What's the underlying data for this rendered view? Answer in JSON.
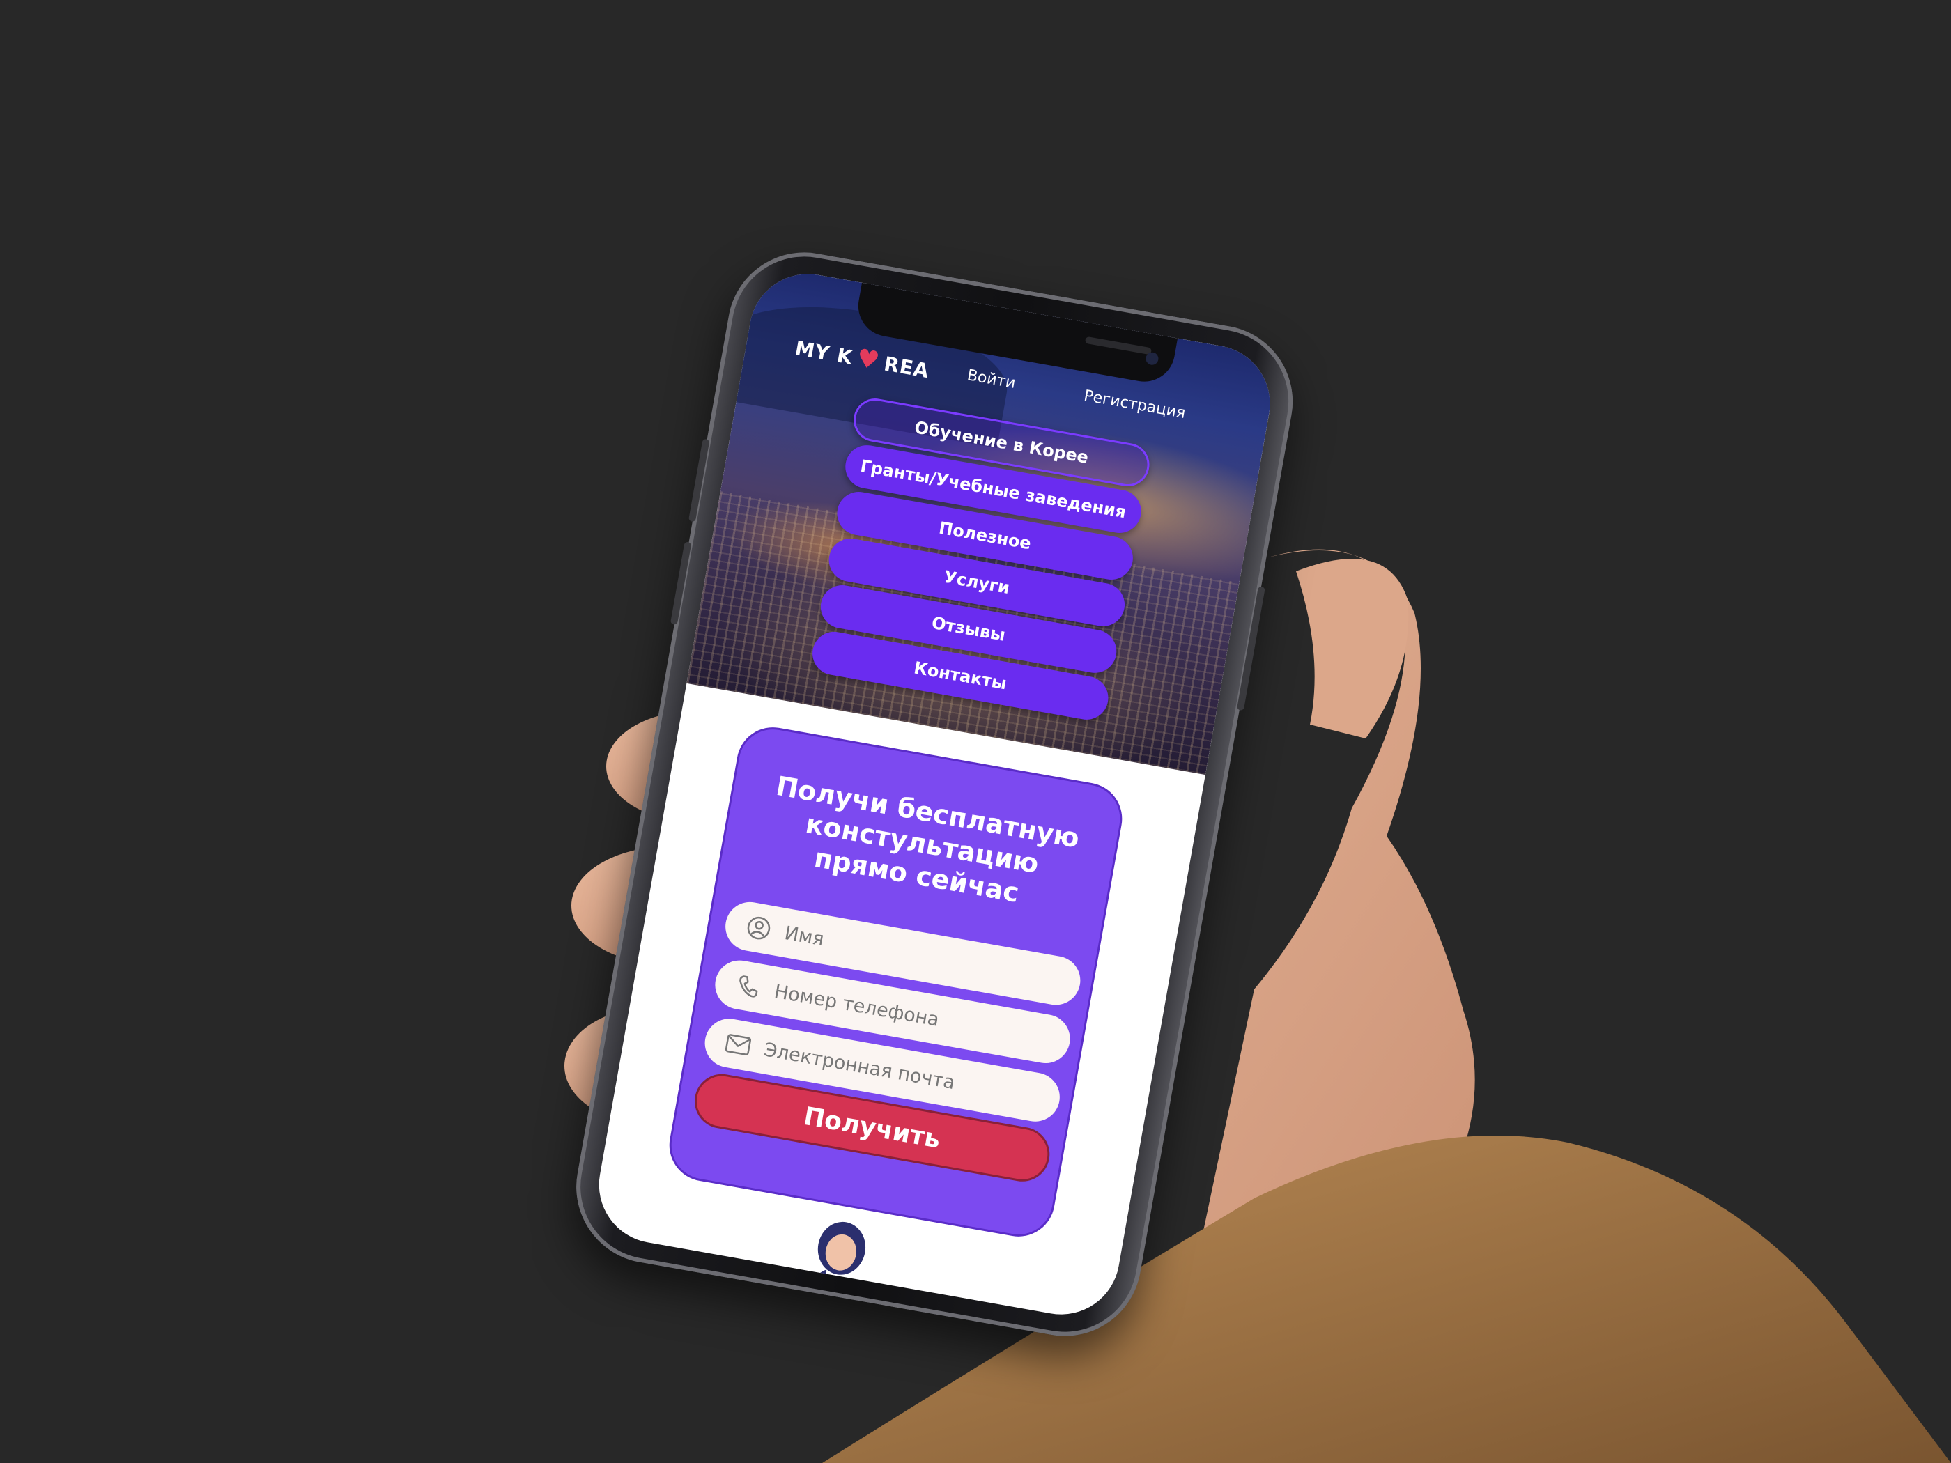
{
  "site": {
    "logo_text_left": "MY K",
    "logo_text_right": "REA"
  },
  "header": {
    "login_label": "Войти",
    "register_label": "Регистрация"
  },
  "menu": {
    "items": [
      {
        "label": "Обучение в Корее"
      },
      {
        "label": "Гранты/Учебные заведения"
      },
      {
        "label": "Полезное"
      },
      {
        "label": "Услуги"
      },
      {
        "label": "Отзывы"
      },
      {
        "label": "Контакты"
      }
    ]
  },
  "form": {
    "title": "Получи бесплатную констультацию прямо сейчас",
    "name_placeholder": "Имя",
    "phone_placeholder": "Номер телефона",
    "email_placeholder": "Электронная почта",
    "submit_label": "Получить"
  },
  "colors": {
    "background": "#282828",
    "menu_purple": "#6a2cf0",
    "card_purple": "#7c4af0",
    "submit_red": "#d53352",
    "logo_heart": "#e43b5c"
  }
}
